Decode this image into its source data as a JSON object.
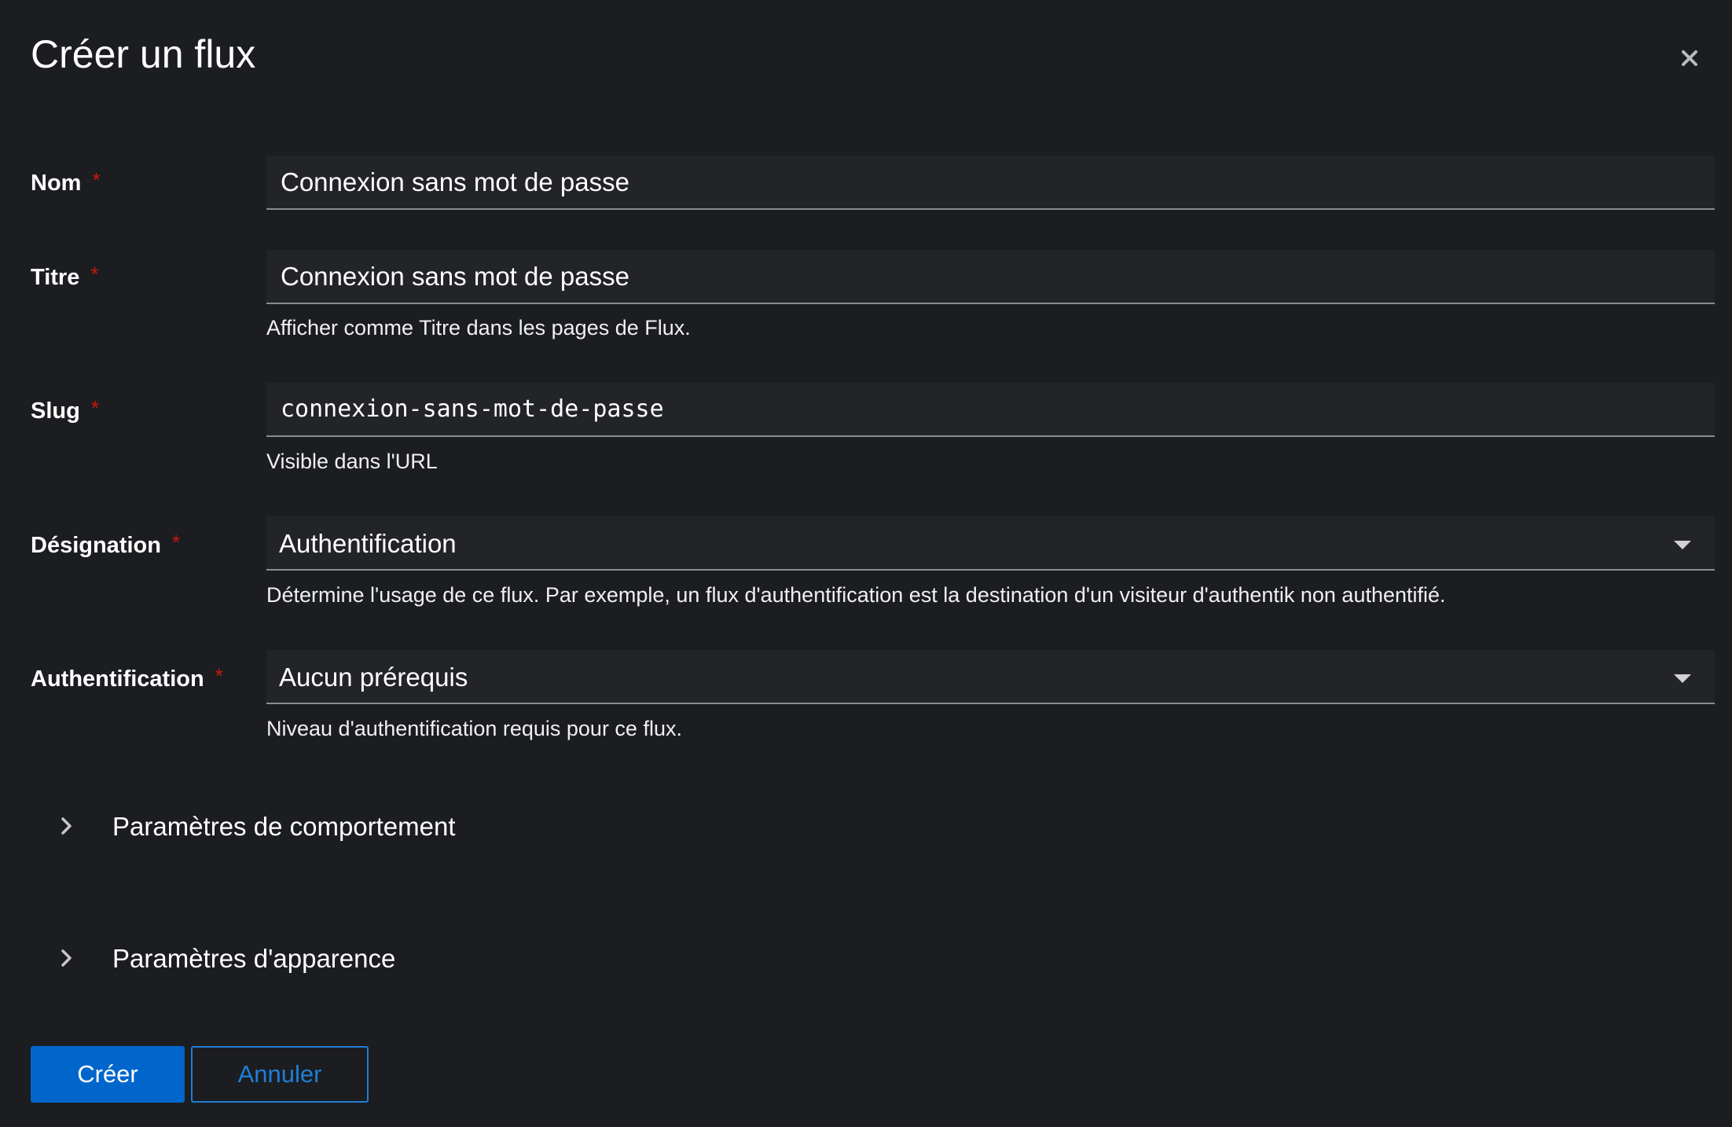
{
  "modal": {
    "title": "Créer un flux",
    "close_icon": "close-icon"
  },
  "form": {
    "required_marker": "*",
    "name": {
      "label": "Nom",
      "value": "Connexion sans mot de passe"
    },
    "title": {
      "label": "Titre",
      "value": "Connexion sans mot de passe",
      "helper": "Afficher comme Titre dans les pages de Flux."
    },
    "slug": {
      "label": "Slug",
      "value": "connexion-sans-mot-de-passe",
      "helper": "Visible dans l'URL"
    },
    "designation": {
      "label": "Désignation",
      "selected": "Authentification",
      "helper": "Détermine l'usage de ce flux. Par exemple, un flux d'authentification est la destination d'un visiteur d'authentik non authentifié."
    },
    "authentication": {
      "label": "Authentification",
      "selected": "Aucun prérequis",
      "helper": "Niveau d'authentification requis pour ce flux."
    }
  },
  "sections": [
    {
      "label": "Paramètres de comportement",
      "icon": "chevron-right-icon",
      "expanded": false
    },
    {
      "label": "Paramètres d'apparence",
      "icon": "chevron-right-icon",
      "expanded": false
    }
  ],
  "footer": {
    "create_label": "Créer",
    "cancel_label": "Annuler"
  },
  "colors": {
    "background": "#1b1d21",
    "field_background": "#222428",
    "required": "#c9190b",
    "primary": "#0066cc",
    "link": "#1f7ed6"
  }
}
